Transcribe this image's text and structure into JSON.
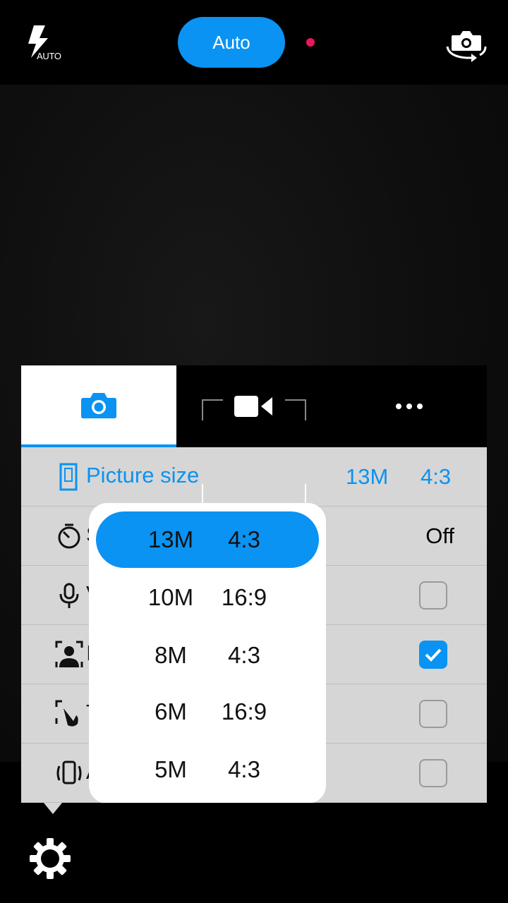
{
  "topbar": {
    "flash_label": "AUTO",
    "mode_label": "Auto",
    "rec_color": "#f0145a",
    "accent": "#0a93f2"
  },
  "tabs": [
    {
      "icon": "camera-icon",
      "selected": true
    },
    {
      "icon": "video-camera-icon",
      "selected": false
    },
    {
      "icon": "more-dots-icon",
      "selected": false
    }
  ],
  "settings": {
    "picture_size": {
      "label": "Picture size",
      "megapixels": "13M",
      "ratio": "4:3"
    },
    "rows": [
      {
        "icon": "self-timer-icon",
        "label_visible": "S",
        "value": "Off"
      },
      {
        "icon": "microphone-icon",
        "label_visible": "V",
        "checked": false
      },
      {
        "icon": "face-detection-icon",
        "label_visible": "I",
        "checked": true
      },
      {
        "icon": "touch-shutter-icon",
        "label_visible": "T",
        "checked": false
      },
      {
        "icon": "anti-shake-phone-icon",
        "label_visible": "A",
        "checked": false
      }
    ]
  },
  "picture_size_options": [
    {
      "mp": "13M",
      "ratio": "4:3",
      "selected": true
    },
    {
      "mp": "10M",
      "ratio": "16:9",
      "selected": false
    },
    {
      "mp": "8M",
      "ratio": "4:3",
      "selected": false
    },
    {
      "mp": "6M",
      "ratio": "16:9",
      "selected": false
    },
    {
      "mp": "5M",
      "ratio": "4:3",
      "selected": false
    }
  ]
}
